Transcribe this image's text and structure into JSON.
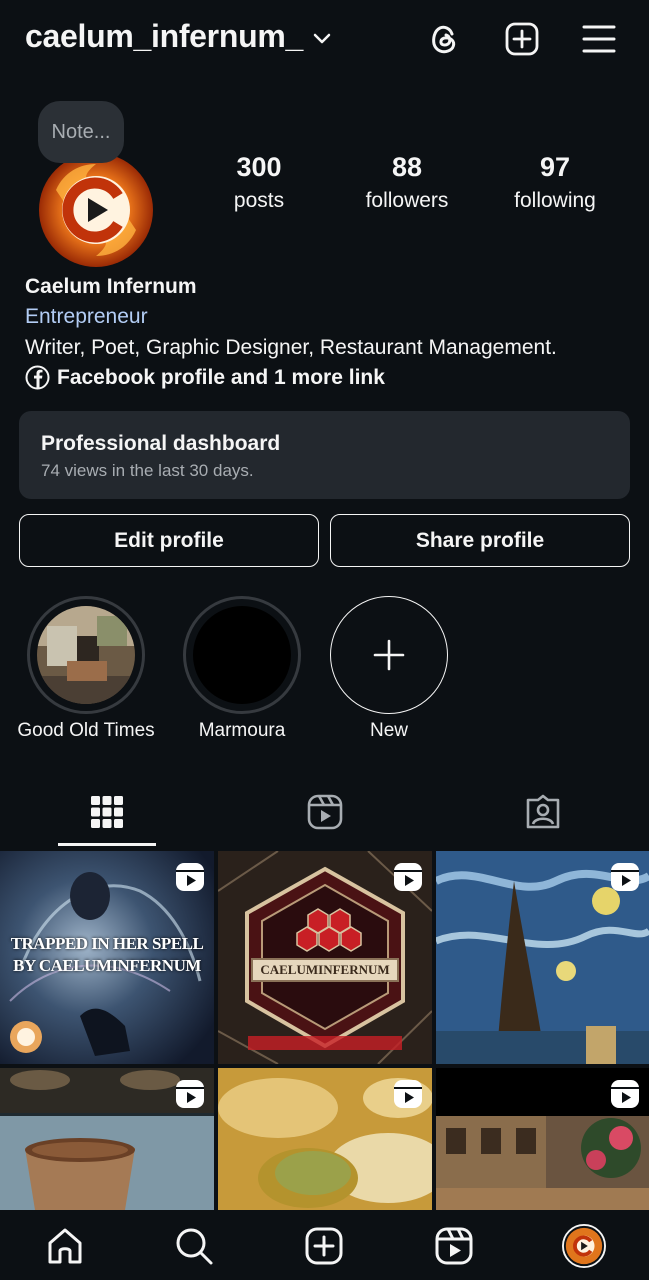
{
  "header": {
    "username": "caelum_infernum_",
    "icons": [
      "chevron-down-icon",
      "threads-icon",
      "create-plus-icon",
      "menu-icon"
    ]
  },
  "profile": {
    "note_placeholder": "Note...",
    "stats": {
      "posts": {
        "value": "300",
        "label": "posts"
      },
      "followers": {
        "value": "88",
        "label": "followers"
      },
      "following": {
        "value": "97",
        "label": "following"
      }
    },
    "full_name": "Caelum Infernum",
    "category": "Entrepreneur",
    "bio": "Writer, Poet, Graphic Designer, Restaurant Management.",
    "links_label": "Facebook profile and 1 more link"
  },
  "dashboard": {
    "title": "Professional dashboard",
    "subtitle": "74 views in the last 30 days."
  },
  "buttons": {
    "edit_profile": "Edit profile",
    "share_profile": "Share profile"
  },
  "highlights": [
    {
      "label": "Good Old Times"
    },
    {
      "label": "Marmoura"
    },
    {
      "label": "New"
    }
  ],
  "tabs": [
    "grid-icon",
    "reels-icon",
    "tagged-icon"
  ],
  "grid": {
    "tile1_text_line1": "TRAPPED IN HER SPELL",
    "tile1_text_line2": "BY CAELUMINFERNUM",
    "tile2_text": "CAELUMINFERNUM"
  },
  "bottom_nav": [
    "home-icon",
    "search-icon",
    "create-icon",
    "reels-icon",
    "profile-avatar"
  ],
  "colors": {
    "background": "#0c1014",
    "card": "#23282e",
    "link_blue": "#b3cdf5",
    "secondary_text": "#a8adb2"
  }
}
